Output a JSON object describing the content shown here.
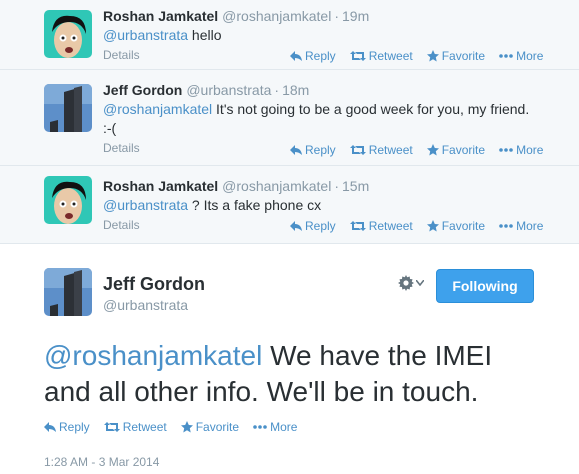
{
  "replies": [
    {
      "fullname": "Roshan Jamkatel",
      "username": "@roshanjamkatel",
      "separator": "·",
      "time": "19m",
      "mention": "@urbanstrata",
      "text": " hello",
      "text2": "",
      "details": "Details"
    },
    {
      "fullname": "Jeff Gordon",
      "username": "@urbanstrata",
      "separator": "·",
      "time": "18m",
      "mention": "@roshanjamkatel",
      "text": " It's not going to be a good week for you, my friend.",
      "text2": ":-(",
      "details": "Details"
    },
    {
      "fullname": "Roshan Jamkatel",
      "username": "@roshanjamkatel",
      "separator": "·",
      "time": "15m",
      "mention": "@urbanstrata",
      "text": " ? Its a fake phone cx",
      "text2": "",
      "details": "Details"
    }
  ],
  "actions": {
    "reply": "Reply",
    "retweet": "Retweet",
    "favorite": "Favorite",
    "more": "More"
  },
  "main": {
    "fullname": "Jeff Gordon",
    "username": "@urbanstrata",
    "follow_label": "Following",
    "mention": "@roshanjamkatel",
    "text_line1": " We have the IMEI",
    "text_line2": "and all other info. We'll be in touch.",
    "timestamp": "1:28 AM - 3 Mar 2014"
  },
  "colors": {
    "link": "#4a90c8",
    "follow_button": "#3ea1ec",
    "muted": "#8899a6",
    "reply_bg": "#f5f8fa"
  }
}
